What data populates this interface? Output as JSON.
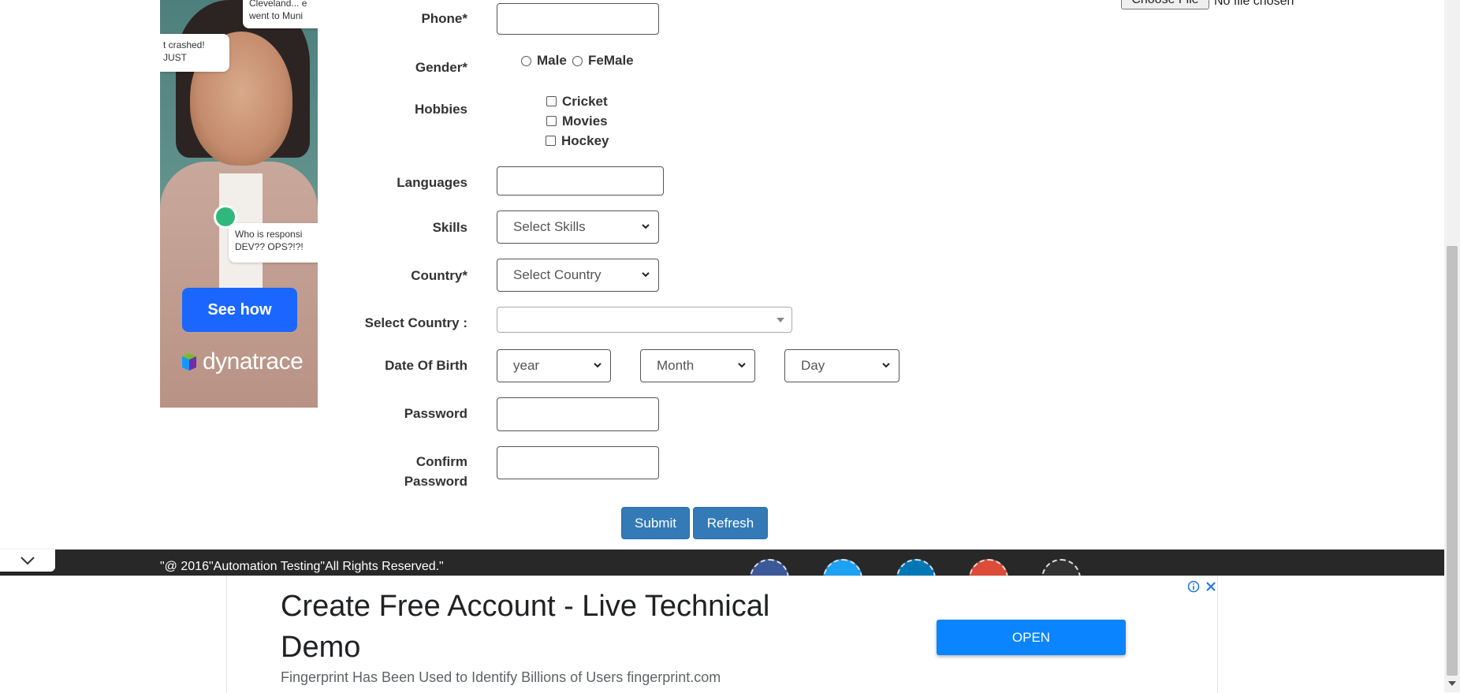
{
  "side_ad": {
    "bubble_top": "Cleveland... e\nwent to Muni",
    "bubble_crash": "t crashed!\nJUST",
    "bubble_who": "Who is responsi\nDEV?? OPS?!?!",
    "cta": "See how",
    "brand": "dynatrace"
  },
  "form": {
    "phone_label": "Phone*",
    "gender_label": "Gender*",
    "gender_options": [
      "Male",
      "FeMale"
    ],
    "hobbies_label": "Hobbies",
    "hobbies": [
      "Cricket",
      "Movies",
      "Hockey"
    ],
    "languages_label": "Languages",
    "skills_label": "Skills",
    "skills_selected": "Select Skills",
    "country_label": "Country*",
    "country_selected": "Select Country",
    "select_country_label": "Select Country :",
    "select_country_value": "",
    "dob_label": "Date Of Birth",
    "dob_year": "year",
    "dob_month": "Month",
    "dob_day": "Day",
    "password_label": "Password",
    "confirm_label_1": "Confirm",
    "confirm_label_2": "Password",
    "file_button": "Choose File",
    "file_status": "No file chosen",
    "submit": "Submit",
    "refresh": "Refresh"
  },
  "footer": {
    "copyright": "\"@ 2016\"Automation Testing\"All Rights Reserved.\""
  },
  "bottom_ad": {
    "headline": "Create Free Account - Live Technical Demo",
    "description": "Fingerprint Has Been Used to Identify Billions of Users fingerprint.com",
    "cta": "OPEN"
  },
  "colors": {
    "primary_button": "#337ab7",
    "ad_cta": "#0a84ff",
    "footer_bg": "#282828",
    "side_ad_cta": "#1a66ff"
  },
  "icons": [
    "chevron-down-icon",
    "info-icon",
    "close-icon",
    "dynatrace-logo-icon",
    "social-icon"
  ]
}
